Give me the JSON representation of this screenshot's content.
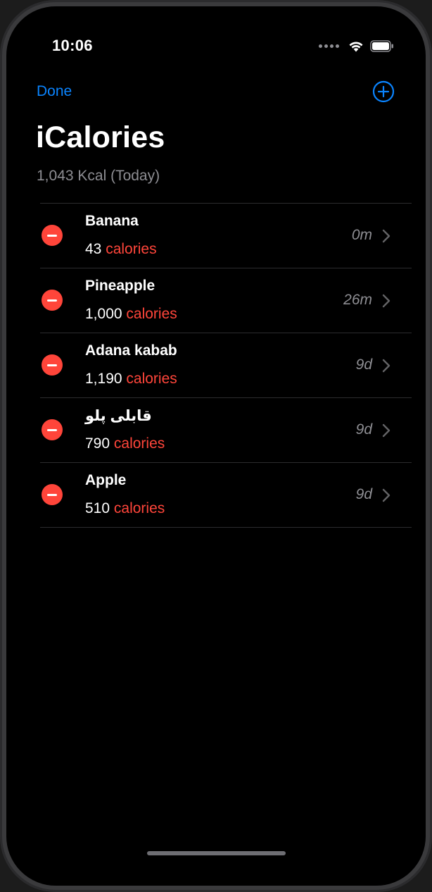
{
  "status_bar": {
    "time": "10:06"
  },
  "nav": {
    "done_label": "Done",
    "add_icon": "plus-circle-icon"
  },
  "header": {
    "title": "iCalories",
    "subtitle": "1,043 Kcal (Today)"
  },
  "colors": {
    "accent": "#0a84ff",
    "delete": "#ff453a",
    "calories_unit": "#ff453a",
    "secondary_text": "#8e8e93",
    "background": "#000000"
  },
  "foods": [
    {
      "name": "Banana",
      "calories": "43",
      "unit": "calories",
      "time": "0m"
    },
    {
      "name": "Pineapple",
      "calories": "1,000",
      "unit": "calories",
      "time": "26m"
    },
    {
      "name": "Adana kabab",
      "calories": "1,190",
      "unit": "calories",
      "time": "9d"
    },
    {
      "name": "قابلی پلو",
      "calories": "790",
      "unit": "calories",
      "time": "9d"
    },
    {
      "name": "Apple",
      "calories": "510",
      "unit": "calories",
      "time": "9d"
    }
  ]
}
